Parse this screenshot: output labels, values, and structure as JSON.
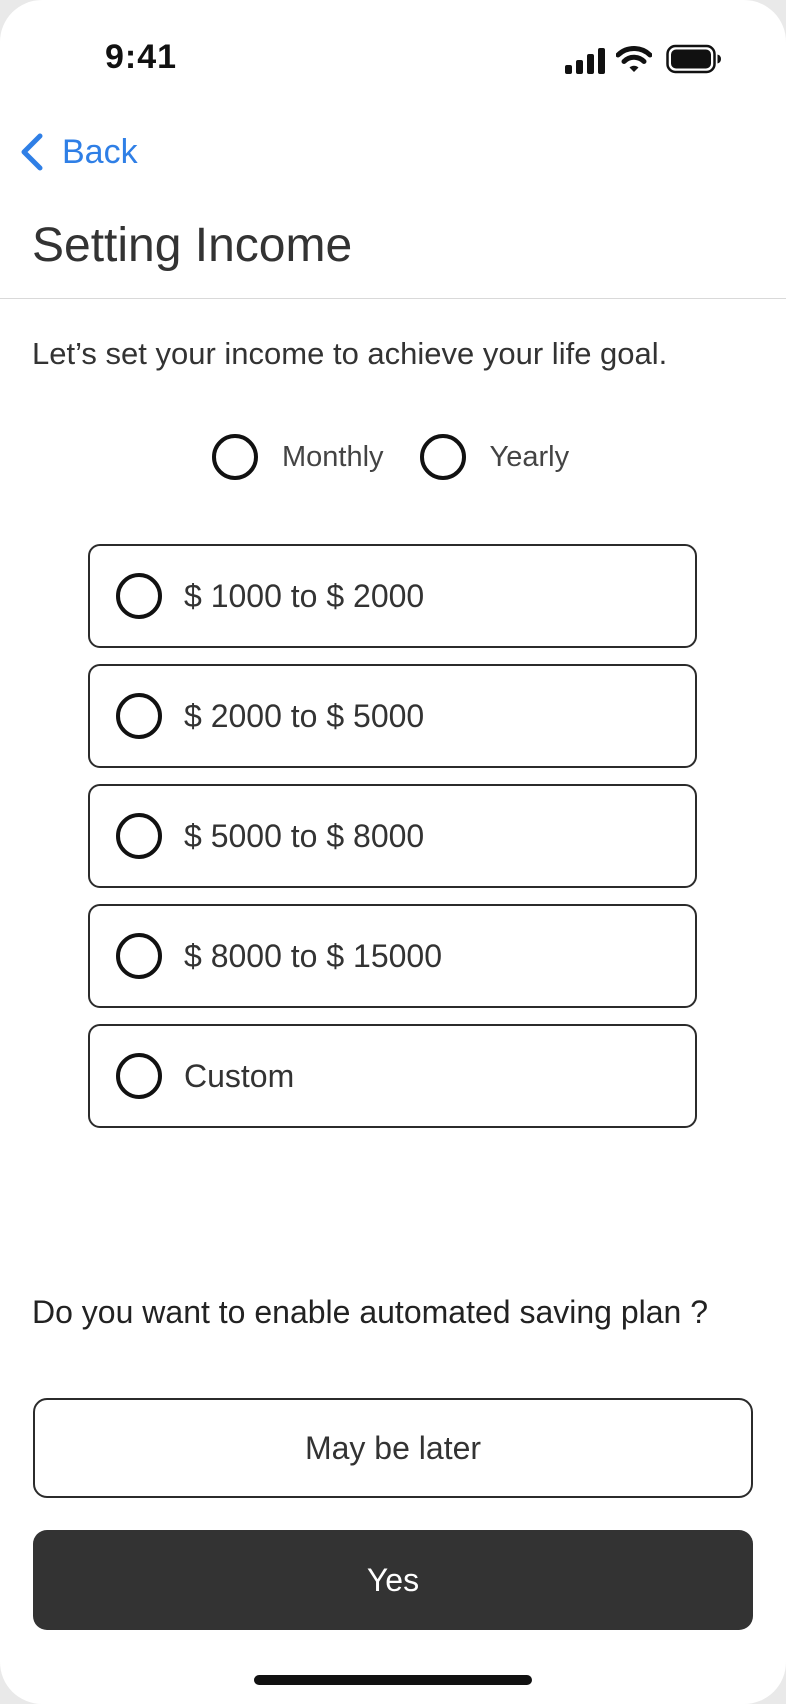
{
  "status_bar": {
    "time": "9:41",
    "icons": [
      "cellular-signal-icon",
      "wifi-icon",
      "battery-icon"
    ]
  },
  "nav": {
    "back_label": "Back",
    "back_icon": "chevron-left-icon"
  },
  "header": {
    "title": "Setting Income"
  },
  "intro_text": "Let’s set your income to achieve your life goal.",
  "period": {
    "options": [
      {
        "label": "Monthly",
        "selected": false
      },
      {
        "label": "Yearly",
        "selected": false
      }
    ]
  },
  "income_ranges": [
    {
      "label": "$ 1000 to $ 2000",
      "selected": false
    },
    {
      "label": "$ 2000 to $ 5000",
      "selected": false
    },
    {
      "label": "$ 5000 to $ 8000",
      "selected": false
    },
    {
      "label": "$ 8000 to $ 15000",
      "selected": false
    },
    {
      "label": "Custom",
      "selected": false
    }
  ],
  "saving_plan": {
    "question": "Do you want to enable automated saving plan ?",
    "later_label": "May be later",
    "yes_label": "Yes"
  },
  "colors": {
    "accent": "#2f7fe6",
    "primary_button": "#333333",
    "text": "#333333",
    "border": "#2b2b2b"
  }
}
